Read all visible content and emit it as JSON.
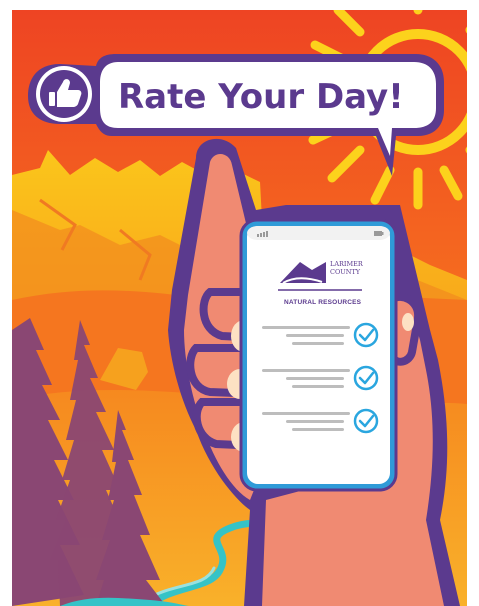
{
  "headline": {
    "text": "Rate Your Day!",
    "icon": "thumbs-up-icon"
  },
  "phone": {
    "logo_line1": "LARIMER",
    "logo_line2": "COUNTY",
    "logo_tagline": "NATURAL RESOURCES",
    "rating_rows": [
      {
        "icon": "checkmark-icon",
        "checked": true
      },
      {
        "icon": "checkmark-icon",
        "checked": true
      },
      {
        "icon": "checkmark-icon",
        "checked": true
      }
    ]
  },
  "colors": {
    "purple": "#5b3a8e",
    "sky_top": "#ef4a22",
    "sky_bottom": "#f99a1c",
    "sun": "#fcd21c",
    "check_blue": "#2aa6df",
    "phone_frame": "#2f9bd8",
    "skin": "#f08a72"
  }
}
